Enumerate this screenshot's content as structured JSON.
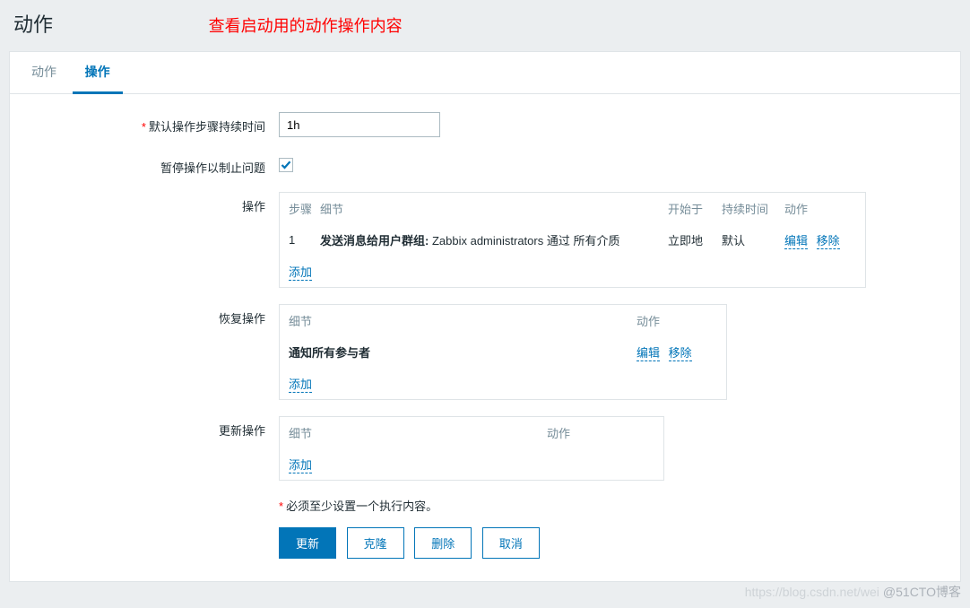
{
  "header": {
    "title": "动作",
    "annotation": "查看启动用的动作操作内容"
  },
  "tabs": [
    {
      "label": "动作",
      "active": false
    },
    {
      "label": "操作",
      "active": true
    }
  ],
  "form": {
    "duration_label": "默认操作步骤持续时间",
    "duration_value": "1h",
    "pause_label": "暂停操作以制止问题",
    "operations": {
      "label": "操作",
      "headers": {
        "step": "步骤",
        "detail": "细节",
        "start": "开始于",
        "duration": "持续时间",
        "action": "动作"
      },
      "rows": [
        {
          "step": "1",
          "detail_prefix": "发送消息给用户群组:",
          "detail_rest": " Zabbix administrators 通过 所有介质",
          "start": "立即地",
          "duration": "默认",
          "edit": "编辑",
          "remove": "移除"
        }
      ],
      "add": "添加"
    },
    "recovery": {
      "label": "恢复操作",
      "headers": {
        "detail": "细节",
        "action": "动作"
      },
      "rows": [
        {
          "detail": "通知所有参与者",
          "edit": "编辑",
          "remove": "移除"
        }
      ],
      "add": "添加"
    },
    "update": {
      "label": "更新操作",
      "headers": {
        "detail": "细节",
        "action": "动作"
      },
      "add": "添加"
    },
    "validation_msg": "必须至少设置一个执行内容。",
    "buttons": {
      "update": "更新",
      "clone": "克隆",
      "delete": "删除",
      "cancel": "取消"
    }
  },
  "watermark": {
    "faint": "https://blog.csdn.net/wei",
    "text": "@51CTO博客"
  }
}
